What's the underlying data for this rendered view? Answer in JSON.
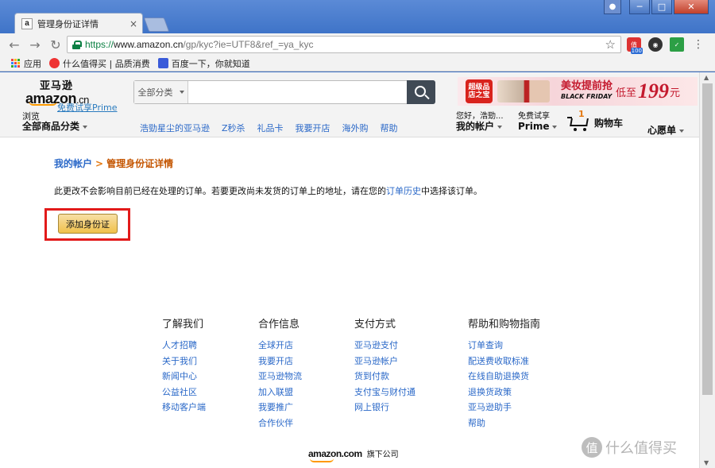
{
  "browser": {
    "tab_title": "管理身份证详情",
    "tab_favicon": "a",
    "tab_close": "×",
    "url_scheme": "https://",
    "url_host": "www.amazon.cn",
    "url_path": "/gp/kyc?ie=UTF8&ref_=ya_kyc",
    "back": "←",
    "forward": "→",
    "reload": "↻",
    "star": "☆",
    "menu": "⋮",
    "ext_badge": "100",
    "win_minimize": "─",
    "win_maximize": "□",
    "win_close": "✕",
    "icons": [
      "back-arrow-icon",
      "forward-arrow-icon",
      "reload-icon",
      "lock-icon",
      "star-icon",
      "extension-icon",
      "menu-icon"
    ]
  },
  "bookmarks": {
    "items": [
      {
        "label": "应用"
      },
      {
        "label": "什么值得买 | 品质消费"
      },
      {
        "label": "百度一下，你就知道"
      }
    ]
  },
  "header": {
    "logo_cn": "亚马逊",
    "logo_main": "amazon",
    "logo_suffix": ".cn",
    "logo_prime": "免费试享Prime",
    "search_category": "全部分类",
    "search_placeholder": "",
    "promo": {
      "seal": "超级品店之宝",
      "text": "美妆提前抢",
      "tag": "BLACK FRIDAY",
      "sub": "低至",
      "price": "199",
      "unit": "元"
    },
    "browse_small": "浏览",
    "browse_big": "全部商品分类",
    "nav_links": [
      "浩勁星尘的亚马逊",
      "Z秒杀",
      "礼品卡",
      "我要开店",
      "海外购",
      "帮助"
    ],
    "account_small": "您好，浩勁...",
    "account_big": "我的帐户",
    "prime_small": "免费试享",
    "prime_big": "Prime",
    "cart_count": "1",
    "cart_label": "购物车",
    "wishlist": "心愿单"
  },
  "main": {
    "breadcrumb_parent": "我的帐户",
    "breadcrumb_sep": ">",
    "breadcrumb_current": "管理身份证详情",
    "info_before": "此更改不会影响目前已经在处理的订单。若要更改尚未发货的订单上的地址，请在您的",
    "info_link": "订单历史",
    "info_after": "中选择该订单。",
    "add_button": "添加身份证"
  },
  "footer": {
    "columns": [
      {
        "title": "了解我们",
        "links": [
          "人才招聘",
          "关于我们",
          "新闻中心",
          "公益社区",
          "移动客户端"
        ]
      },
      {
        "title": "合作信息",
        "links": [
          "全球开店",
          "我要开店",
          "亚马逊物流",
          "加入联盟",
          "我要推广",
          "合作伙伴"
        ]
      },
      {
        "title": "支付方式",
        "links": [
          "亚马逊支付",
          "亚马逊帐户",
          "货到付款",
          "支付宝与财付通",
          "网上银行"
        ]
      },
      {
        "title": "帮助和购物指南",
        "links": [
          "订单查询",
          "配送费收取标准",
          "在线自助退换货",
          "退换货政策",
          "亚马逊助手",
          "帮助"
        ]
      }
    ],
    "bottom_logo": "amazon.com",
    "bottom_text": "旗下公司"
  },
  "watermark": {
    "badge": "值",
    "text": "什么值得买"
  },
  "colors": {
    "link": "#2a68c8",
    "breadcrumb_current": "#c45500",
    "button_yellow": "#f0c14b",
    "highlight_red": "#e21a1a",
    "header_bg": "#f3f3f3"
  }
}
